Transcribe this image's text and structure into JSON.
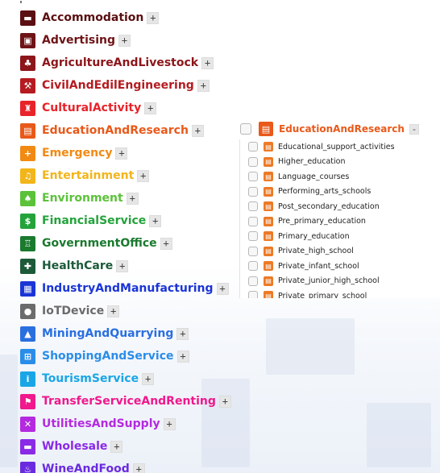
{
  "categories": [
    {
      "label": "Accommodation",
      "color": "#5a0f12",
      "icon": "bed-icon",
      "glyph": "▬"
    },
    {
      "label": "Advertising",
      "color": "#6e1316",
      "icon": "billboard-icon",
      "glyph": "▣"
    },
    {
      "label": "AgricultureAndLivestock",
      "color": "#8c161b",
      "icon": "tractor-icon",
      "glyph": "♣"
    },
    {
      "label": "CivilAndEdilEngineering",
      "color": "#b51b20",
      "icon": "worker-icon",
      "glyph": "⚒"
    },
    {
      "label": "CulturalActivity",
      "color": "#e8232a",
      "icon": "temple-icon",
      "glyph": "♜"
    },
    {
      "label": "EducationAndResearch",
      "color": "#e8591a",
      "icon": "book-icon",
      "glyph": "▤"
    },
    {
      "label": "Emergency",
      "color": "#f18a12",
      "icon": "cross-icon",
      "glyph": "+"
    },
    {
      "label": "Entertainment",
      "color": "#f2b51a",
      "icon": "theater-icon",
      "glyph": "♫"
    },
    {
      "label": "Environment",
      "color": "#5cc23a",
      "icon": "tree-icon",
      "glyph": "♠"
    },
    {
      "label": "FinancialService",
      "color": "#24a33b",
      "icon": "money-icon",
      "glyph": "$"
    },
    {
      "label": "GovernmentOffice",
      "color": "#1a7a2e",
      "icon": "building-icon",
      "glyph": "♖"
    },
    {
      "label": "HealthCare",
      "color": "#1d5a3a",
      "icon": "hospital-icon",
      "glyph": "✚"
    },
    {
      "label": "IndustryAndManufacturing",
      "color": "#1a35d6",
      "icon": "factory-icon",
      "glyph": "▦"
    },
    {
      "label": "IoTDevice",
      "color": "#6b6b6b",
      "icon": "location-pin-icon",
      "glyph": "●"
    },
    {
      "label": "MiningAndQuarrying",
      "color": "#2a6fe0",
      "icon": "mine-icon",
      "glyph": "▲"
    },
    {
      "label": "ShoppingAndService",
      "color": "#2a8de8",
      "icon": "cart-icon",
      "glyph": "⊞"
    },
    {
      "label": "TourismService",
      "color": "#1aa6e6",
      "icon": "info-icon",
      "glyph": "i"
    },
    {
      "label": "TransferServiceAndRenting",
      "color": "#f0188c",
      "icon": "car-rental-icon",
      "glyph": "⚑"
    },
    {
      "label": "UtilitiesAndSupply",
      "color": "#b42ae0",
      "icon": "tools-icon",
      "glyph": "✕"
    },
    {
      "label": "Wholesale",
      "color": "#8a2ae6",
      "icon": "truck-icon",
      "glyph": "▬"
    },
    {
      "label": "WineAndFood",
      "color": "#6a2ae0",
      "icon": "wine-icon",
      "glyph": "♨"
    }
  ],
  "expand_label": "+",
  "expanded": {
    "label": "EducationAndResearch",
    "collapse_label": "-",
    "icon": "book-icon",
    "glyph": "▤",
    "color": "#e8591a",
    "items": [
      "Educational_support_activities",
      "Higher_education",
      "Language_courses",
      "Performing_arts_schools",
      "Post_secondary_education",
      "Pre_primary_education",
      "Primary_education",
      "Private_high_school",
      "Private_infant_school",
      "Private_junior_high_school",
      "Private_primary_school"
    ]
  }
}
